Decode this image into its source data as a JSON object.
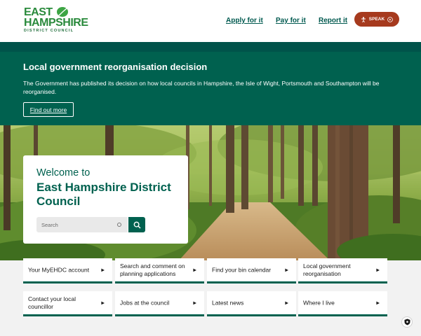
{
  "header": {
    "logo": {
      "line1": "EAST",
      "line2": "HAMPSHIRE",
      "line3": "DISTRICT COUNCIL"
    },
    "links": [
      "Apply for it",
      "Pay for it",
      "Report it"
    ],
    "speak_label": "SPEAK"
  },
  "banner": {
    "title": "Local government reorganisation decision",
    "text": "The Government has published its decision on how local councils in Hampshire, the Isle of Wight, Portsmouth and Southampton will be reorganised.",
    "button_label": "Find out more"
  },
  "welcome": {
    "line1": "Welcome to",
    "line2": "East Hampshire District Council",
    "search_placeholder": "Search"
  },
  "tiles": [
    {
      "label": "Your MyEHDC account"
    },
    {
      "label": "Search and comment on planning applications"
    },
    {
      "label": "Find your bin calendar"
    },
    {
      "label": "Local government reorganisation"
    },
    {
      "label": "Contact your local councillor"
    },
    {
      "label": "Jobs at the council"
    },
    {
      "label": "Latest news"
    },
    {
      "label": "Where I live"
    }
  ],
  "icons": {
    "speak": "play-circle-icon",
    "speak_person": "person-icon",
    "search": "search-icon",
    "tile_arrow": "caret-right-icon",
    "cookie": "shield-icon",
    "logo_leaf": "leaf-icon"
  },
  "colors": {
    "brand_green": "#00614f",
    "logo_green": "#2a8a3c",
    "speak_button": "#a63a1e",
    "background": "#f2f2f2"
  }
}
